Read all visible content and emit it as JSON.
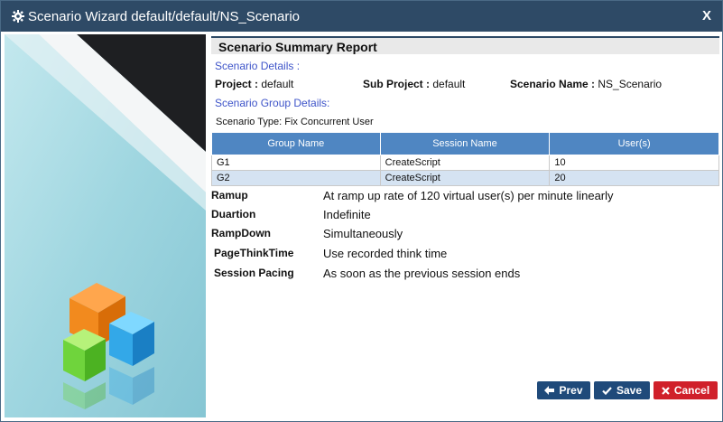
{
  "window": {
    "title": "Scenario Wizard default/default/NS_Scenario",
    "close_label": "X"
  },
  "report": {
    "header": "Scenario Summary Report",
    "scenario_details_label": "Scenario Details :",
    "project_label": "Project :",
    "project_value": "default",
    "sub_project_label": "Sub Project :",
    "sub_project_value": "default",
    "scenario_name_label": "Scenario Name :",
    "scenario_name_value": "NS_Scenario",
    "group_details_label": "Scenario Group Details:",
    "scenario_type": "Scenario Type: Fix Concurrent User"
  },
  "groups_table": {
    "columns": [
      "Group Name",
      "Session Name",
      "User(s)"
    ],
    "rows": [
      {
        "group": "G1",
        "session": "CreateScript",
        "users": "10"
      },
      {
        "group": "G2",
        "session": "CreateScript",
        "users": "20"
      }
    ]
  },
  "properties": [
    {
      "key": "Ramup",
      "value": "At ramp up rate of 120 virtual user(s) per minute linearly"
    },
    {
      "key": "Duartion",
      "value": "Indefinite"
    },
    {
      "key": "RampDown",
      "value": "Simultaneously"
    },
    {
      "key": "PageThinkTime",
      "value": "Use recorded think time"
    },
    {
      "key": "Session Pacing",
      "value": "As soon as the previous session ends"
    }
  ],
  "buttons": {
    "prev": "Prev",
    "save": "Save",
    "cancel": "Cancel"
  },
  "colors": {
    "titlebar": "#2e4a66",
    "table_header": "#4f86c2",
    "link": "#3e54c9",
    "primary_button": "#1f4a7a",
    "cancel_button": "#d0202a"
  },
  "icons": {
    "title": "gear-icon",
    "prev": "arrow-left-icon",
    "save": "check-icon",
    "cancel": "times-icon"
  }
}
